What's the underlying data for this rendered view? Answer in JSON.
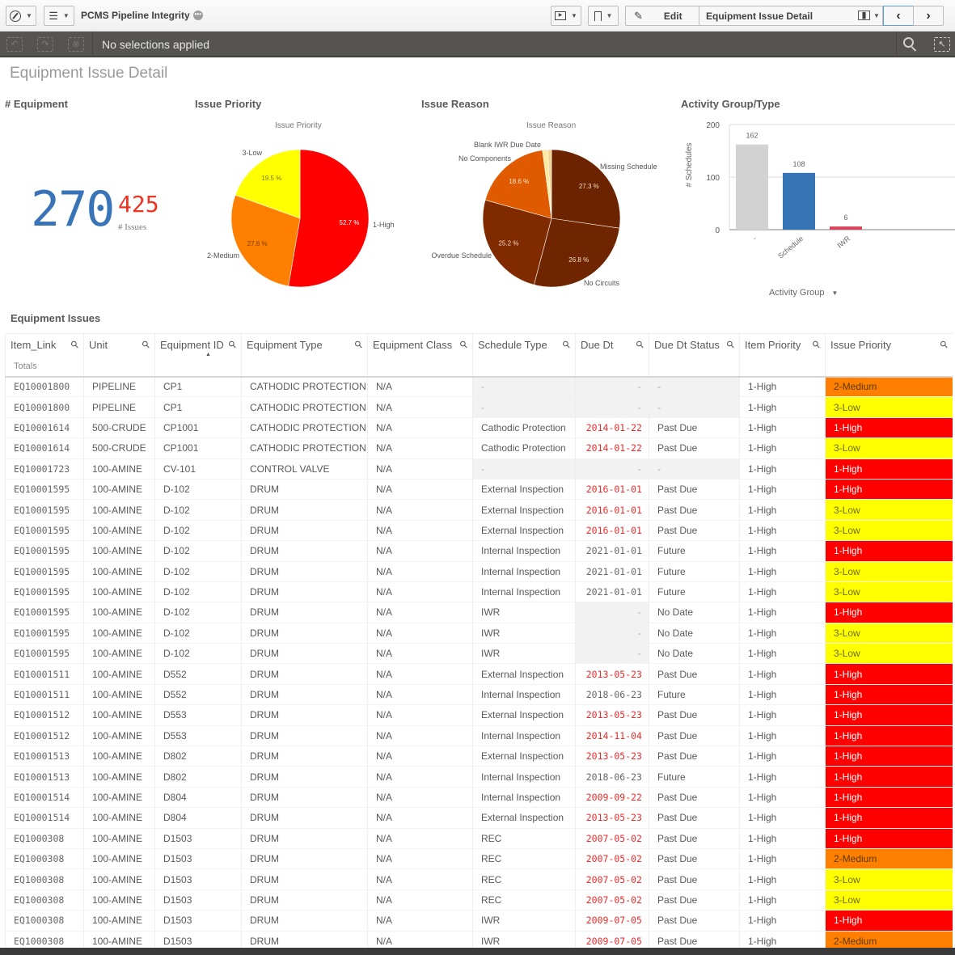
{
  "toolbar": {
    "app_title": "PCMS Pipeline Integrity",
    "edit_label": "Edit",
    "sheet_name": "Equipment Issue Detail",
    "icons": [
      "compass-icon",
      "list-icon",
      "present-icon",
      "bookmark-icon",
      "pencil-icon",
      "chart-icon",
      "chevron-left-icon",
      "chevron-right-icon"
    ]
  },
  "selections": {
    "text": "No selections applied"
  },
  "sheet": {
    "title": "Equipment Issue Detail"
  },
  "kpi": {
    "title": "# Equipment",
    "equipment_count": "270",
    "issues_count": "425",
    "issues_label": "# Issues",
    "colors": {
      "main": "#3a74b8",
      "sub": "#ee3322"
    }
  },
  "issue_priority": {
    "panel_title": "Issue Priority"
  },
  "issue_reason": {
    "panel_title": "Issue Reason"
  },
  "activity": {
    "panel_title": "Activity Group/Type",
    "dimension_label": "Activity Group"
  },
  "chart_data": [
    {
      "type": "pie",
      "title": "Issue Priority",
      "categories": [
        "1-High",
        "2-Medium",
        "3-Low"
      ],
      "values": [
        52.7,
        27.8,
        19.5
      ],
      "labels": [
        "52.7 %",
        "27.8 %",
        "19.5 %"
      ],
      "colors": [
        "#ff0000",
        "#ff8000",
        "#ffff00"
      ]
    },
    {
      "type": "pie",
      "title": "Issue Reason",
      "categories": [
        "Missing Schedule",
        "No Circuits",
        "Overdue Schedule",
        "No Components",
        "Blank IWR Due Date",
        ""
      ],
      "values": [
        27.3,
        26.8,
        25.2,
        18.6,
        1.2,
        0.9
      ],
      "labels": [
        "27.3 %",
        "26.8 %",
        "25.2 %",
        "18.6 %",
        "",
        ""
      ],
      "colors": [
        "#6b2300",
        "#6e2500",
        "#802a00",
        "#e05a00",
        "#fbeaa0",
        "#f5d590"
      ]
    },
    {
      "type": "bar",
      "title": "Activity Group/Type",
      "categories": [
        "-",
        "Schedule",
        "IWR"
      ],
      "values": [
        162,
        108,
        6
      ],
      "colors": [
        "#d2d2d2",
        "#3674b5",
        "#d8455a"
      ],
      "xlabel": "Activity Group",
      "ylabel": "# Schedules",
      "yticks": [
        "0",
        "100",
        "200"
      ],
      "ylim": [
        0,
        200
      ],
      "grid": true
    }
  ],
  "table": {
    "title": "Equipment Issues",
    "totals_label": "Totals",
    "columns": [
      "Item_Link",
      "Unit",
      "Equipment ID",
      "Equipment Type",
      "Equipment Class",
      "Schedule Type",
      "Due Dt",
      "Due Dt Status",
      "Item Priority",
      "Issue Priority"
    ],
    "rows": [
      [
        "EQ10001800",
        "PIPELINE",
        "CP1",
        "CATHODIC PROTECTION",
        "N/A",
        "-",
        "-",
        "-",
        "1-High",
        "2-Medium"
      ],
      [
        "EQ10001800",
        "PIPELINE",
        "CP1",
        "CATHODIC PROTECTION",
        "N/A",
        "-",
        "-",
        "-",
        "1-High",
        "3-Low"
      ],
      [
        "EQ10001614",
        "500-CRUDE",
        "CP1001",
        "CATHODIC PROTECTION",
        "N/A",
        "Cathodic Protection",
        "2014-01-22",
        "Past Due",
        "1-High",
        "1-High"
      ],
      [
        "EQ10001614",
        "500-CRUDE",
        "CP1001",
        "CATHODIC PROTECTION",
        "N/A",
        "Cathodic Protection",
        "2014-01-22",
        "Past Due",
        "1-High",
        "3-Low"
      ],
      [
        "EQ10001723",
        "100-AMINE",
        "CV-101",
        "CONTROL VALVE",
        "N/A",
        "-",
        "-",
        "-",
        "1-High",
        "1-High"
      ],
      [
        "EQ10001595",
        "100-AMINE",
        "D-102",
        "DRUM",
        "N/A",
        "External Inspection",
        "2016-01-01",
        "Past Due",
        "1-High",
        "1-High"
      ],
      [
        "EQ10001595",
        "100-AMINE",
        "D-102",
        "DRUM",
        "N/A",
        "External Inspection",
        "2016-01-01",
        "Past Due",
        "1-High",
        "3-Low"
      ],
      [
        "EQ10001595",
        "100-AMINE",
        "D-102",
        "DRUM",
        "N/A",
        "External Inspection",
        "2016-01-01",
        "Past Due",
        "1-High",
        "3-Low"
      ],
      [
        "EQ10001595",
        "100-AMINE",
        "D-102",
        "DRUM",
        "N/A",
        "Internal Inspection",
        "2021-01-01",
        "Future",
        "1-High",
        "1-High"
      ],
      [
        "EQ10001595",
        "100-AMINE",
        "D-102",
        "DRUM",
        "N/A",
        "Internal Inspection",
        "2021-01-01",
        "Future",
        "1-High",
        "3-Low"
      ],
      [
        "EQ10001595",
        "100-AMINE",
        "D-102",
        "DRUM",
        "N/A",
        "Internal Inspection",
        "2021-01-01",
        "Future",
        "1-High",
        "3-Low"
      ],
      [
        "EQ10001595",
        "100-AMINE",
        "D-102",
        "DRUM",
        "N/A",
        "IWR",
        "-",
        "No Date",
        "1-High",
        "1-High"
      ],
      [
        "EQ10001595",
        "100-AMINE",
        "D-102",
        "DRUM",
        "N/A",
        "IWR",
        "-",
        "No Date",
        "1-High",
        "3-Low"
      ],
      [
        "EQ10001595",
        "100-AMINE",
        "D-102",
        "DRUM",
        "N/A",
        "IWR",
        "-",
        "No Date",
        "1-High",
        "3-Low"
      ],
      [
        "EQ10001511",
        "100-AMINE",
        "D552",
        "DRUM",
        "N/A",
        "External Inspection",
        "2013-05-23",
        "Past Due",
        "1-High",
        "1-High"
      ],
      [
        "EQ10001511",
        "100-AMINE",
        "D552",
        "DRUM",
        "N/A",
        "Internal Inspection",
        "2018-06-23",
        "Future",
        "1-High",
        "1-High"
      ],
      [
        "EQ10001512",
        "100-AMINE",
        "D553",
        "DRUM",
        "N/A",
        "External Inspection",
        "2013-05-23",
        "Past Due",
        "1-High",
        "1-High"
      ],
      [
        "EQ10001512",
        "100-AMINE",
        "D553",
        "DRUM",
        "N/A",
        "Internal Inspection",
        "2014-11-04",
        "Past Due",
        "1-High",
        "1-High"
      ],
      [
        "EQ10001513",
        "100-AMINE",
        "D802",
        "DRUM",
        "N/A",
        "External Inspection",
        "2013-05-23",
        "Past Due",
        "1-High",
        "1-High"
      ],
      [
        "EQ10001513",
        "100-AMINE",
        "D802",
        "DRUM",
        "N/A",
        "Internal Inspection",
        "2018-06-23",
        "Future",
        "1-High",
        "1-High"
      ],
      [
        "EQ10001514",
        "100-AMINE",
        "D804",
        "DRUM",
        "N/A",
        "Internal Inspection",
        "2009-09-22",
        "Past Due",
        "1-High",
        "1-High"
      ],
      [
        "EQ10001514",
        "100-AMINE",
        "D804",
        "DRUM",
        "N/A",
        "External Inspection",
        "2013-05-23",
        "Past Due",
        "1-High",
        "1-High"
      ],
      [
        "EQ1000308",
        "100-AMINE",
        "D1503",
        "DRUM",
        "N/A",
        "REC",
        "2007-05-02",
        "Past Due",
        "1-High",
        "1-High"
      ],
      [
        "EQ1000308",
        "100-AMINE",
        "D1503",
        "DRUM",
        "N/A",
        "REC",
        "2007-05-02",
        "Past Due",
        "1-High",
        "2-Medium"
      ],
      [
        "EQ1000308",
        "100-AMINE",
        "D1503",
        "DRUM",
        "N/A",
        "REC",
        "2007-05-02",
        "Past Due",
        "1-High",
        "3-Low"
      ],
      [
        "EQ1000308",
        "100-AMINE",
        "D1503",
        "DRUM",
        "N/A",
        "REC",
        "2007-05-02",
        "Past Due",
        "1-High",
        "3-Low"
      ],
      [
        "EQ1000308",
        "100-AMINE",
        "D1503",
        "DRUM",
        "N/A",
        "IWR",
        "2009-07-05",
        "Past Due",
        "1-High",
        "1-High"
      ],
      [
        "EQ1000308",
        "100-AMINE",
        "D1503",
        "DRUM",
        "N/A",
        "IWR",
        "2009-07-05",
        "Past Due",
        "1-High",
        "2-Medium"
      ]
    ]
  }
}
